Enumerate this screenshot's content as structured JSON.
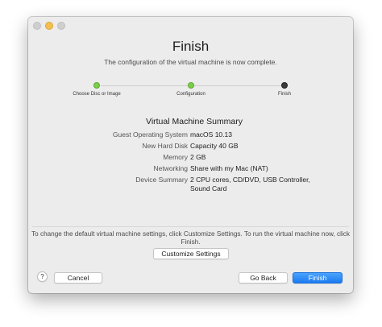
{
  "window": {
    "title": "Finish",
    "subtitle": "The configuration of the virtual machine is now complete."
  },
  "steps": [
    {
      "label": "Choose Disc or Image",
      "state": "done"
    },
    {
      "label": "Configuration",
      "state": "done"
    },
    {
      "label": "Finish",
      "state": "current"
    }
  ],
  "summary": {
    "title": "Virtual Machine Summary",
    "rows": [
      {
        "label": "Guest Operating System",
        "value": "macOS 10.13"
      },
      {
        "label": "New Hard Disk",
        "value": "Capacity 40 GB"
      },
      {
        "label": "Memory",
        "value": "2 GB"
      },
      {
        "label": "Networking",
        "value": "Share with my Mac (NAT)"
      },
      {
        "label": "Device Summary",
        "value": "2 CPU cores, CD/DVD, USB Controller, Sound Card"
      }
    ]
  },
  "hint": "To change the default virtual machine settings, click Customize Settings. To run the virtual machine now, click Finish.",
  "buttons": {
    "customize": "Customize Settings",
    "help": "?",
    "cancel": "Cancel",
    "back": "Go Back",
    "finish": "Finish"
  },
  "colors": {
    "step_done": "#7ccf4a",
    "step_current": "#3a3a3a",
    "primary": "#1d7bf0"
  }
}
